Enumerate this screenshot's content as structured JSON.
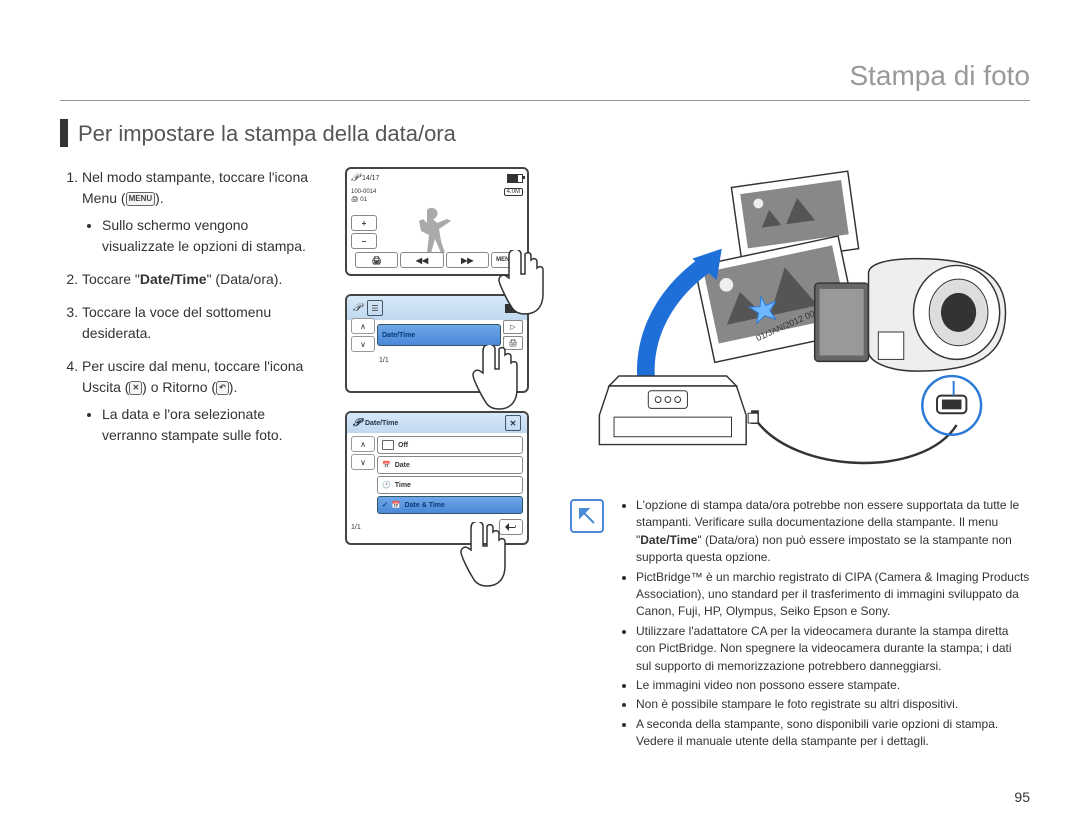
{
  "header_title": "Stampa di foto",
  "section_title": "Per impostare la stampa della data/ora",
  "steps": [
    {
      "text_pre": "Nel modo stampante, toccare l'icona Menu (",
      "icon_label": "MENU",
      "text_post": ").",
      "sub": [
        "Sullo schermo vengono visualizzate le opzioni di stampa."
      ]
    },
    {
      "text_pre": "Toccare \"",
      "bold": "Date/Time",
      "text_post": "\" (Data/ora)."
    },
    {
      "text_pre": "Toccare la voce del sottomenu desiderata."
    },
    {
      "text_pre": "Per uscire dal menu, toccare l'icona Uscita (",
      "icon_x": true,
      "text_mid": ") o Ritorno (",
      "icon_return": true,
      "text_post": ").",
      "sub": [
        "La data e l'ora selezionate verranno stampate sulle foto."
      ]
    }
  ],
  "screen1": {
    "counter": "14/17",
    "file": "100-0014",
    "badge": "4.0M",
    "copies": "01",
    "menu_label": "MENU"
  },
  "screen2": {
    "item_label": "Date/Time",
    "pager": "1/1"
  },
  "screen3": {
    "title": "Date/Time",
    "options": [
      "Off",
      "Date",
      "Time",
      "Date & Time"
    ],
    "pager": "1/1"
  },
  "diagram_photo_date": "01/JAN/2012 00:00",
  "notes": [
    "L'opzione di stampa data/ora potrebbe non essere supportata da tutte le stampanti. Verificare sulla documentazione della stampante. Il menu \"<b>Date/Time</b>\" (Data/ora) non può essere impostato se la stampante non supporta questa opzione.",
    "PictBridge™ è un marchio registrato di CIPA (Camera & Imaging Products Association), uno standard per il trasferimento di immagini sviluppato da Canon, Fuji, HP, Olympus, Seiko Epson e Sony.",
    "Utilizzare l'adattatore CA per la videocamera durante la stampa diretta con PictBridge. Non spegnere la videocamera durante la stampa; i dati sul supporto di memorizzazione potrebbero danneggiarsi.",
    "Le immagini video non possono essere stampate.",
    "Non è possibile stampare le foto registrate su altri dispositivi.",
    "A seconda della stampante, sono disponibili varie opzioni di stampa. Vedere il manuale utente della stampante per i dettagli."
  ],
  "page_number": "95"
}
